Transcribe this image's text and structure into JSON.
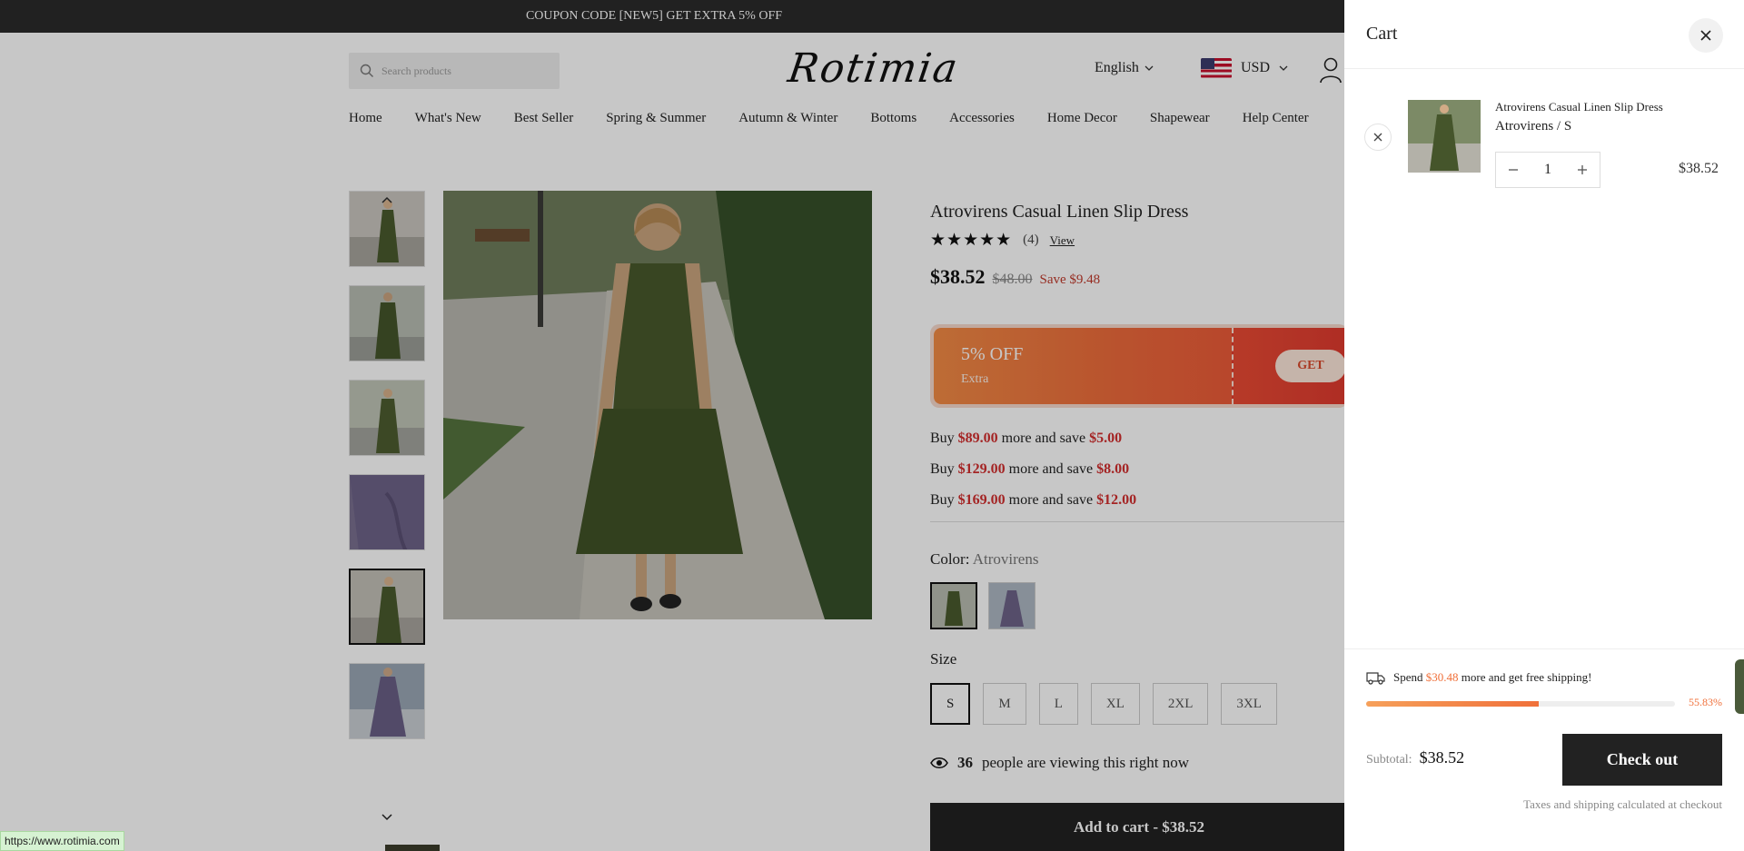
{
  "announcement": "COUPON CODE [NEW5] GET EXTRA 5% OFF",
  "header": {
    "search_placeholder": "Search products",
    "logo": "Rotimia",
    "language": "English",
    "currency": "USD"
  },
  "nav": [
    "Home",
    "What's New",
    "Best Seller",
    "Spring & Summer",
    "Autumn & Winter",
    "Bottoms",
    "Accessories",
    "Home Decor",
    "Shapewear",
    "Help Center"
  ],
  "product": {
    "title": "Atrovirens Casual Linen Slip Dress",
    "rating": 4.5,
    "stars": "★★★★★",
    "review_count": "(4)",
    "view_label": "View",
    "price": "$38.52",
    "compare_price": "$48.00",
    "save": "Save $9.48",
    "coupon": {
      "title": "5% OFF",
      "subtitle": "Extra",
      "button": "GET"
    },
    "tiers": [
      {
        "pre": "Buy ",
        "amount": "$89.00",
        "mid": " more and save ",
        "save": "$5.00"
      },
      {
        "pre": "Buy ",
        "amount": "$129.00",
        "mid": " more and save ",
        "save": "$8.00"
      },
      {
        "pre": "Buy ",
        "amount": "$169.00",
        "mid": " more and save ",
        "save": "$12.00"
      }
    ],
    "color_label": "Color: ",
    "color_value": "Atrovirens",
    "size_label": "Size",
    "sizes": [
      "S",
      "M",
      "L",
      "XL",
      "2XL",
      "3XL"
    ],
    "viewers_count": "36",
    "viewers_text": "people are viewing this right now",
    "add_to_cart": "Add to cart - $38.52"
  },
  "cart": {
    "title": "Cart",
    "item": {
      "name": "Atrovirens Casual Linen Slip Dress",
      "variant": "Atrovirens / S",
      "quantity": "1",
      "price": "$38.52"
    },
    "shipping": {
      "pre": "Spend ",
      "amount": "$30.48",
      "post": " more and get free shipping!",
      "percent": "55.83%",
      "progress": 0.5583
    },
    "subtotal_label": "Subtotal:",
    "subtotal_value": "$38.52",
    "checkout": "Check out",
    "taxes_note": "Taxes and shipping calculated at checkout"
  },
  "status_url": "https://www.rotimia.com",
  "colors": {
    "accent_orange": "#f0703a",
    "sale_red": "#d32f2f",
    "dress_green": "#4a5a2e",
    "dress_purple": "#6e6388"
  },
  "icons": [
    "search-icon",
    "chevron-down-icon",
    "user-icon",
    "chevron-up-icon",
    "star-icon",
    "eye-icon",
    "close-icon",
    "minus-icon",
    "plus-icon",
    "truck-icon"
  ]
}
